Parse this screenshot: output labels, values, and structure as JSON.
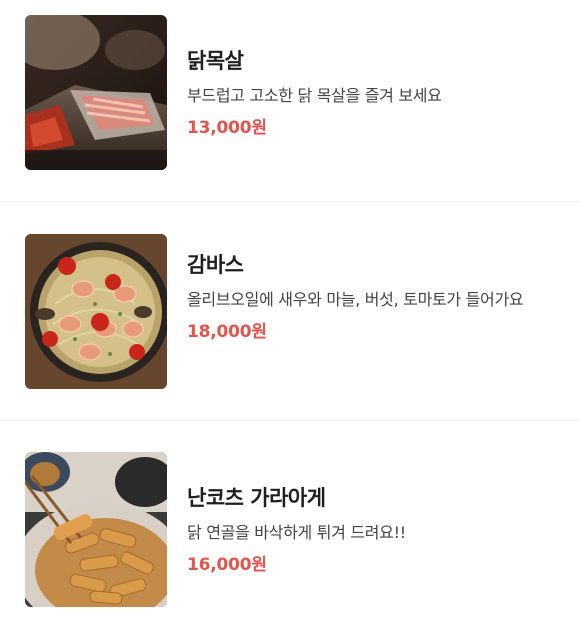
{
  "menu": {
    "items": [
      {
        "name": "닭목살",
        "description": "부드럽고 고소한 닭 목살을 즐겨 보세요",
        "price": "13,000원",
        "image_icon": "grilled-chicken-neck-photo"
      },
      {
        "name": "감바스",
        "description": "올리브오일에 새우와 마늘, 버섯, 토마토가 들어가요",
        "price": "18,000원",
        "image_icon": "gambas-shrimp-pan-photo"
      },
      {
        "name": "난코츠 가라아게",
        "description": "닭 연골을 바삭하게 튀겨 드려요!!",
        "price": "16,000원",
        "image_icon": "fried-chicken-cartilage-photo"
      }
    ]
  },
  "colors": {
    "price": "#e0554e",
    "name": "#1f1f1f",
    "description": "#444444",
    "divider": "#efefef"
  }
}
